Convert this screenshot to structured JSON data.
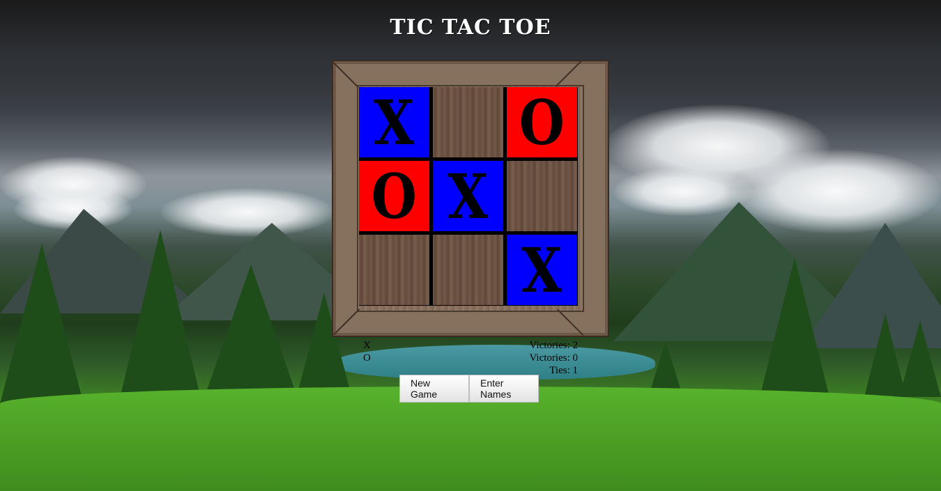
{
  "title": "TIC TAC TOE",
  "board": {
    "cells": [
      "X",
      "",
      "O",
      "O",
      "X",
      "",
      "",
      "",
      "X"
    ]
  },
  "scoreboard": {
    "left_lines": [
      "X",
      "O"
    ],
    "right_lines": [
      "Victories: 2",
      "Victories: 0",
      "Ties: 1"
    ]
  },
  "buttons": {
    "new_game": "New Game",
    "enter_names": "Enter Names"
  },
  "colors": {
    "x_cell": "#0000ff",
    "o_cell": "#ff0000",
    "mark": "#000000"
  }
}
